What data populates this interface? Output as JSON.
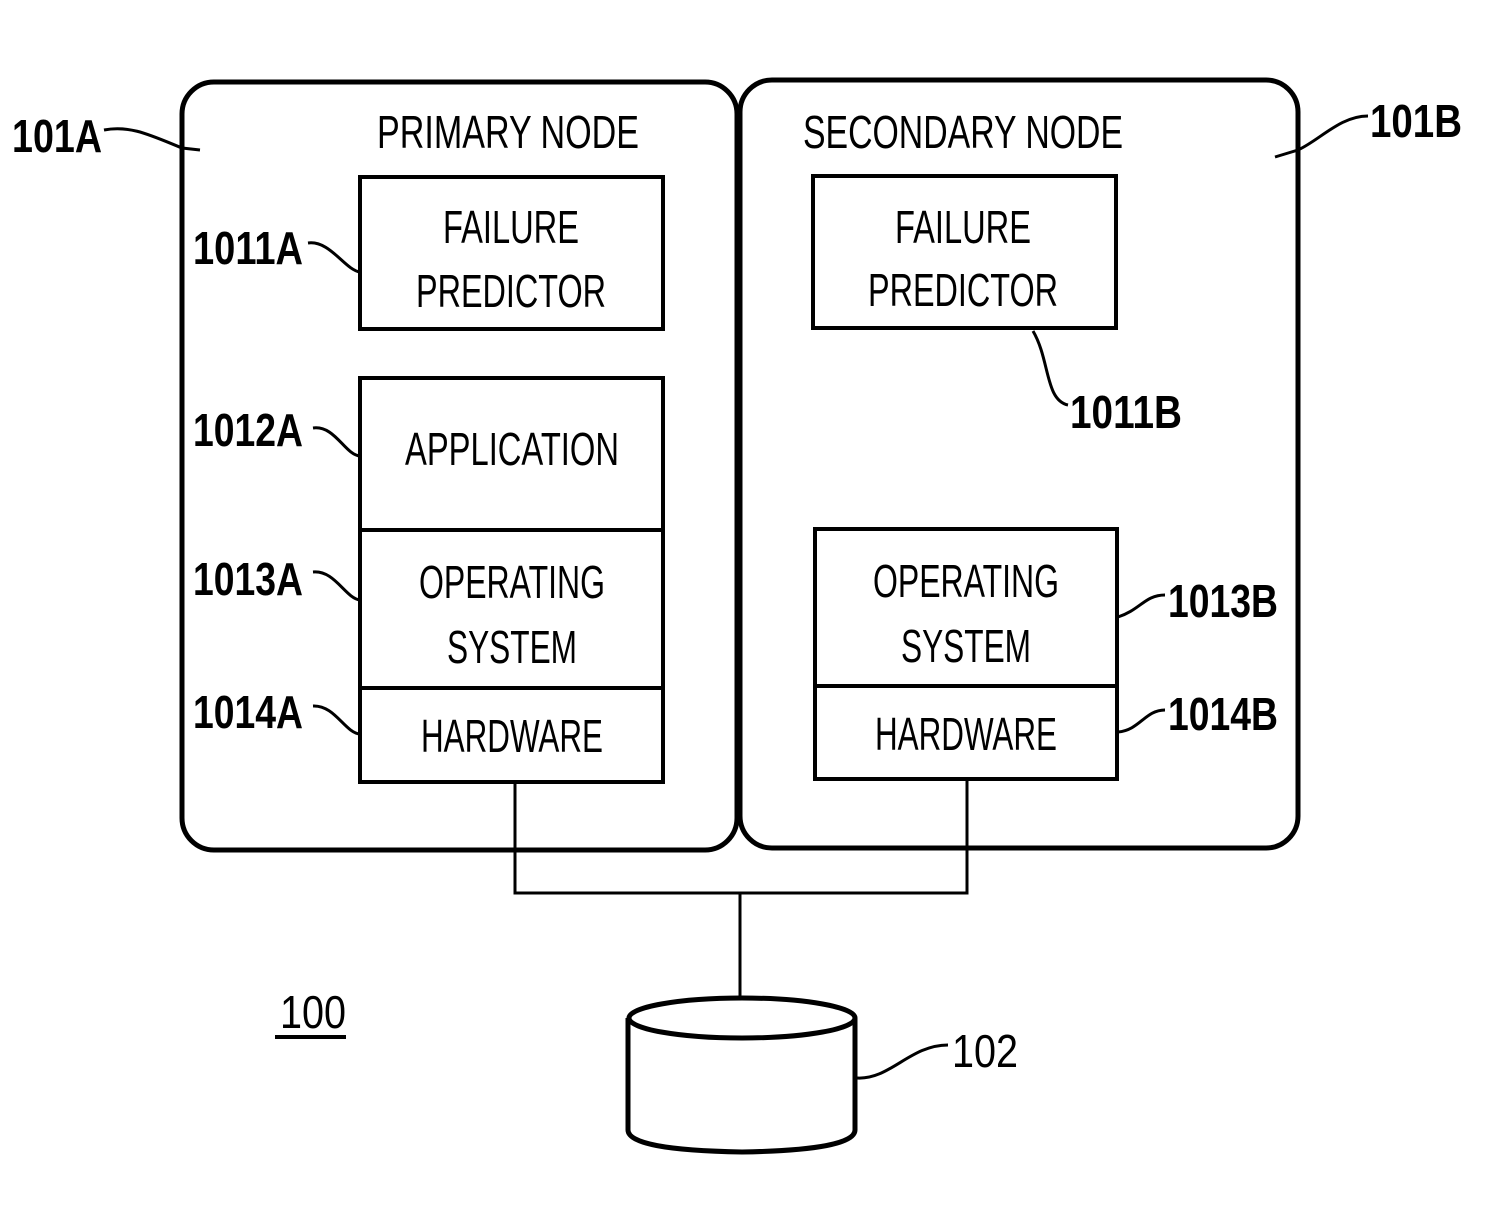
{
  "figure_number": "100",
  "primary_node": {
    "ref": "101A",
    "title": "PRIMARY NODE",
    "failure_predictor": {
      "ref": "1011A",
      "line1": "FAILURE",
      "line2": "PREDICTOR"
    },
    "application": {
      "ref": "1012A",
      "label": "APPLICATION"
    },
    "operating_system": {
      "ref": "1013A",
      "line1": "OPERATING",
      "line2": "SYSTEM"
    },
    "hardware": {
      "ref": "1014A",
      "label": "HARDWARE"
    }
  },
  "secondary_node": {
    "ref": "101B",
    "title": "SECONDARY NODE",
    "failure_predictor": {
      "ref": "1011B",
      "line1": "FAILURE",
      "line2": "PREDICTOR"
    },
    "operating_system": {
      "ref": "1013B",
      "line1": "OPERATING",
      "line2": "SYSTEM"
    },
    "hardware": {
      "ref": "1014B",
      "label": "HARDWARE"
    }
  },
  "storage": {
    "ref": "102"
  }
}
